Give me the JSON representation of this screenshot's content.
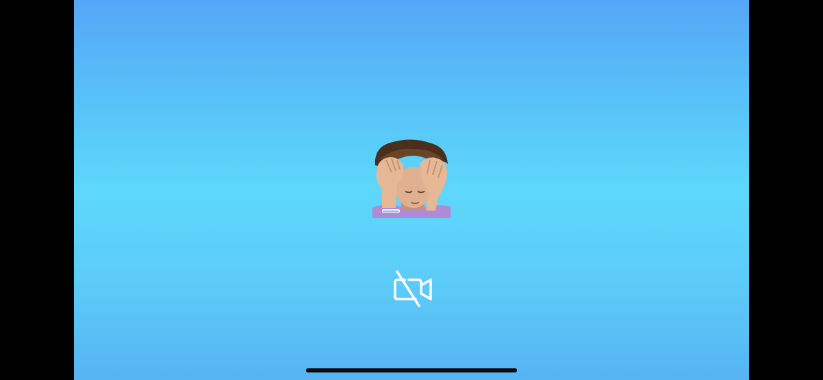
{
  "screen": {
    "background_top": "#55a7f7",
    "background_mid": "#5dd8fb",
    "background_bottom": "#56b4f2"
  },
  "sticker": {
    "icon": "person-holding-head-sticker"
  },
  "controls": {
    "camera_toggle_icon": "video-camera-off-icon",
    "camera_state": "off"
  },
  "home_indicator": {
    "color": "#0a0a0a"
  }
}
